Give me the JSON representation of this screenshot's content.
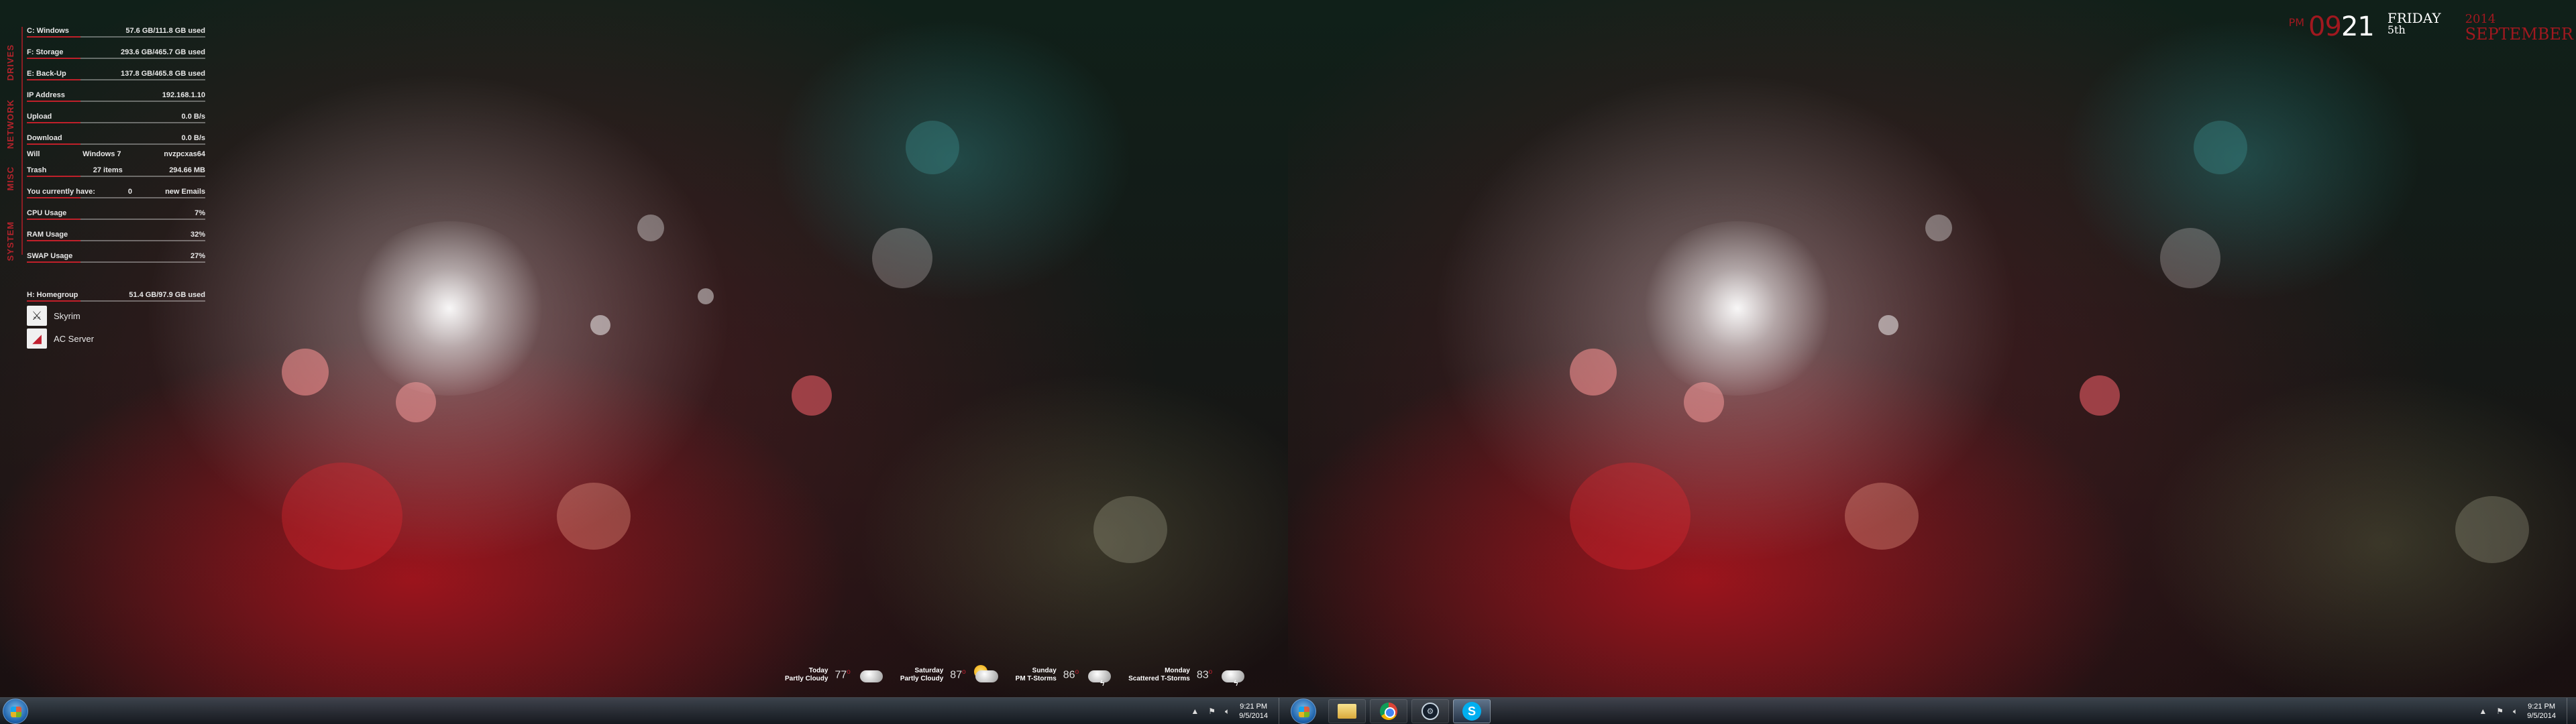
{
  "system_monitor": {
    "section_labels": [
      "DRIVES",
      "NETWORK",
      "MISC",
      "SYSTEM"
    ],
    "drives": [
      {
        "label": "C: Windows",
        "value": "57.6 GB/111.8 GB used"
      },
      {
        "label": "F: Storage",
        "value": "293.6 GB/465.7 GB used"
      },
      {
        "label": "E: Back-Up",
        "value": "137.8 GB/465.8 GB used"
      }
    ],
    "network": [
      {
        "label": "IP Address",
        "value": "192.168.1.10"
      },
      {
        "label": "Upload",
        "value": "0.0 B/s"
      },
      {
        "label": "Download",
        "value": "0.0 B/s"
      }
    ],
    "misc": {
      "win_label": "Will",
      "win_mid": "Windows 7",
      "win_value": "nvzpcxas64",
      "trash_label": "Trash",
      "trash_mid": "27 items",
      "trash_value": "294.66 MB",
      "mail_label": "You currently have:",
      "mail_count": "0",
      "mail_value": "new Emails"
    },
    "system": [
      {
        "label": "CPU Usage",
        "value": "7%"
      },
      {
        "label": "RAM Usage",
        "value": "32%"
      },
      {
        "label": "SWAP Usage",
        "value": "27%"
      }
    ],
    "extra_drive": {
      "label": "H: Homegroup",
      "value": "51.4 GB/97.9 GB used"
    },
    "apps": [
      {
        "name": "Skyrim",
        "icon": "skyrim-icon",
        "glyph": "⚔"
      },
      {
        "name": "AC Server",
        "icon": "ac-server-icon",
        "glyph": "◢"
      }
    ]
  },
  "weather": [
    {
      "day": "Today",
      "cond": "Partly Cloudy",
      "temp": "77",
      "icon": "partly-cloudy-icon"
    },
    {
      "day": "Saturday",
      "cond": "Partly Cloudy",
      "temp": "87",
      "icon": "sun-cloud-icon"
    },
    {
      "day": "Sunday",
      "cond": "PM T-Storms",
      "temp": "86",
      "icon": "storm-icon"
    },
    {
      "day": "Monday",
      "cond": "Scattered T-Storms",
      "temp": "83",
      "icon": "storm-icon"
    }
  ],
  "clock": {
    "ampm": "PM",
    "hour": "09",
    "minute": "21",
    "day_name": "FRIDAY",
    "day_num": "5th",
    "year": "2014",
    "month": "SEPTEMBER"
  },
  "taskbar_left": {
    "time": "9:21 PM",
    "date": "9/5/2014",
    "tray_icons": [
      "show-hidden-icon",
      "flag-icon",
      "volume-icon"
    ]
  },
  "taskbar_right": {
    "time": "9:21 PM",
    "date": "9/5/2014",
    "pinned": [
      "windows-explorer",
      "chrome",
      "steam",
      "skype"
    ],
    "tray_icons": [
      "show-hidden-icon",
      "flag-icon",
      "volume-icon"
    ]
  },
  "colors": {
    "accent": "#a0181f",
    "text": "#e8e8e8"
  }
}
